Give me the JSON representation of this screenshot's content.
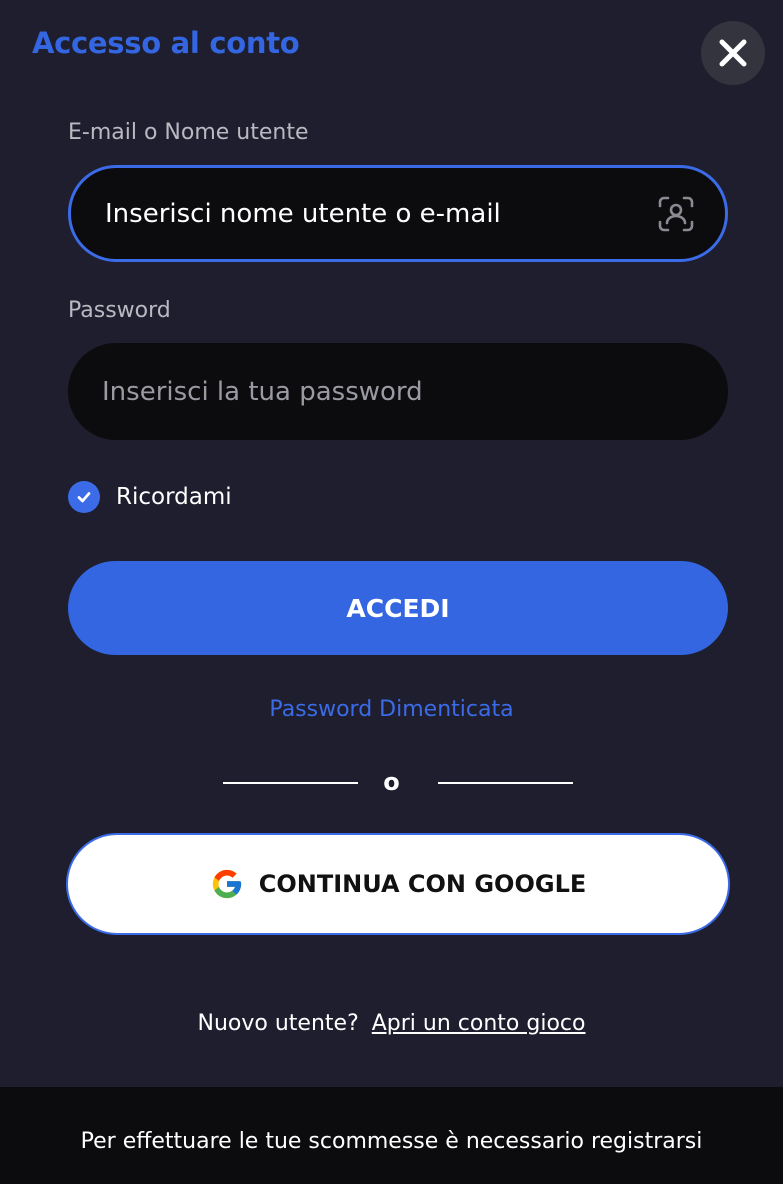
{
  "dialog": {
    "title": "Accesso al conto",
    "close_icon": "close-icon"
  },
  "login": {
    "email_label": "E-mail o Nome utente",
    "email_placeholder": "Inserisci nome utente o e-mail",
    "email_value": "",
    "face_id_icon": "face-id-icon",
    "password_label": "Password",
    "password_placeholder": "Inserisci la tua password",
    "password_value": "",
    "remember_label": "Ricordami",
    "remember_checked": true,
    "submit_label": "ACCEDI",
    "forgot_label": "Password Dimenticata"
  },
  "divider": {
    "text": "o"
  },
  "google": {
    "icon": "google-icon",
    "label": "CONTINUA CON GOOGLE"
  },
  "register": {
    "prompt": "Nuovo utente?",
    "link_label": "Apri un conto gioco"
  },
  "footer": {
    "text": "Per effettuare le tue scommesse è necessario registrarsi"
  },
  "colors": {
    "background": "#1e1e2e",
    "accent": "#3366e0",
    "input_bg": "#0c0c0f",
    "footer_bg": "#0c0c0f"
  }
}
